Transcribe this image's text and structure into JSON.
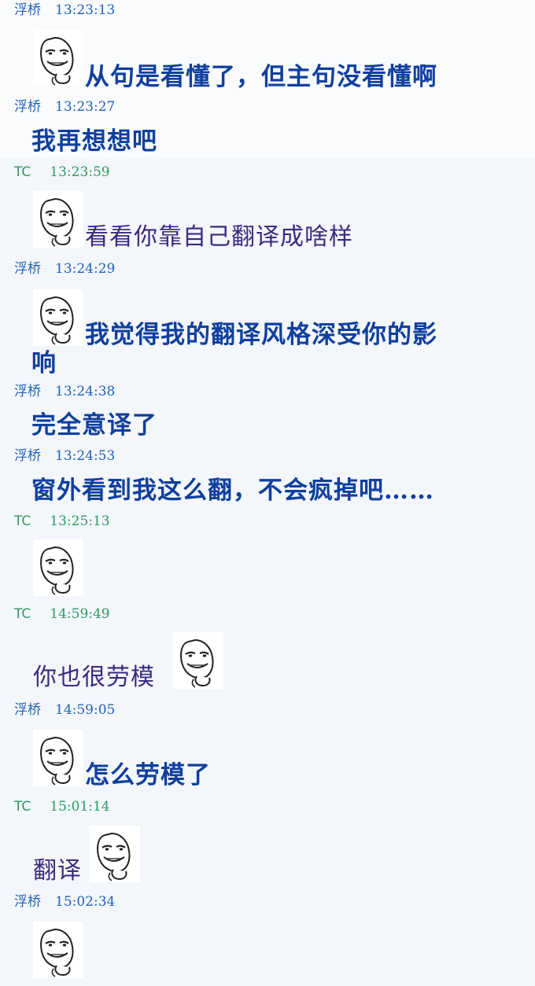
{
  "messages": [
    {
      "sender": "浮桥",
      "time": "13:23:13",
      "text": ""
    },
    {
      "sender": "",
      "time": "",
      "text": "从句是看懂了，但主句没看懂啊"
    },
    {
      "sender": "浮桥",
      "time": "13:23:27",
      "text": "我再想想吧"
    },
    {
      "sender": "TC",
      "time": "13:23:59",
      "text": "看看你靠自己翻译成啥样"
    },
    {
      "sender": "浮桥",
      "time": "13:24:29",
      "text_line1": "我觉得我的翻译风格深受你的影",
      "text_line2": "响"
    },
    {
      "sender": "浮桥",
      "time": "13:24:38",
      "text": "完全意译了"
    },
    {
      "sender": "浮桥",
      "time": "13:24:53",
      "text": "窗外看到我这么翻，不会疯掉吧……"
    },
    {
      "sender": "TC",
      "time": "13:25:13",
      "text": ""
    },
    {
      "sender": "TC",
      "time": "14:59:49",
      "text": "你也很劳模"
    },
    {
      "sender": "浮桥",
      "time": "14:59:05",
      "text": "怎么劳模了"
    },
    {
      "sender": "TC",
      "time": "15:01:14",
      "text": "翻译"
    },
    {
      "sender": "浮桥",
      "time": "15:02:34",
      "text": ""
    }
  ],
  "emoticon": "smirk-face-icon",
  "colors": {
    "fuqiao": "#1f62b8",
    "tc": "#2e9a5f",
    "fuqiao_text": "#0f3f9e",
    "tc_text": "#3b2b7f",
    "background": "#f3f6fb"
  }
}
